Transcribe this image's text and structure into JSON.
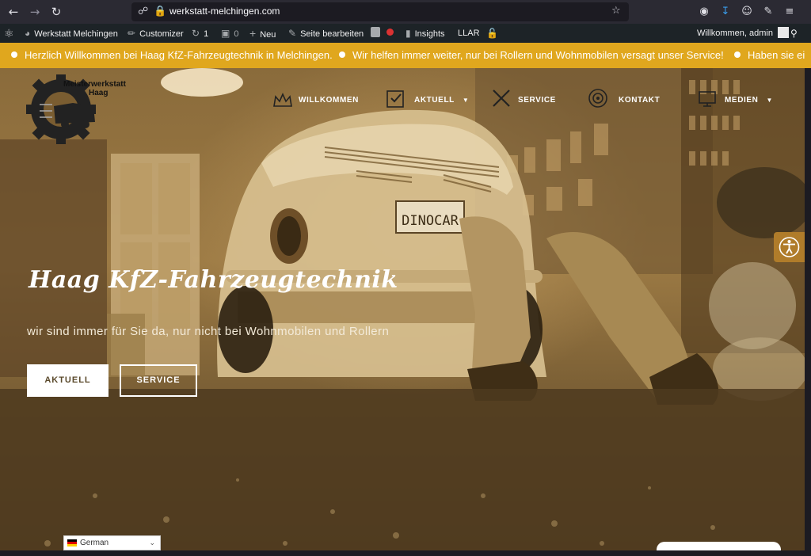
{
  "browser": {
    "url": "werkstatt-melchingen.com"
  },
  "wp_admin_bar": {
    "site_name": "Werkstatt Melchingen",
    "customizer": "Customizer",
    "updates_count": "1",
    "comments_count": "0",
    "new_label": "Neu",
    "edit_page": "Seite bearbeiten",
    "insights": "Insights",
    "llar": "LLAR",
    "greeting": "Willkommen, admin"
  },
  "ticker": {
    "items": [
      "Herzlich Willkommen bei Haag KfZ-Fahrzeugtechnik in Melchingen.",
      "Wir helfen immer weiter, nur bei Rollern und Wohnmobilen versagt unser Service!",
      "Haben sie ei"
    ]
  },
  "logo": {
    "line1": "Meisterwerkstatt",
    "line2": "Haag"
  },
  "menu": {
    "items": [
      {
        "label": "WILLKOMMEN",
        "icon": "crown-icon"
      },
      {
        "label": "AKTUELL",
        "icon": "clipboard-check-icon",
        "dropdown": true
      },
      {
        "label": "SERVICE",
        "icon": "wrench-screwdriver-icon"
      },
      {
        "label": "KONTAKT",
        "icon": "target-icon"
      },
      {
        "label": "MEDIEN",
        "icon": "monitor-icon",
        "dropdown": true
      }
    ]
  },
  "hero": {
    "title": "Haag KfZ-Fahrzeugtechnik",
    "subtitle": "wir sind immer für Sie da, nur nicht bei Wohnmobilen und Rollern",
    "button_primary": "AKTUELL",
    "button_secondary": "SERVICE",
    "license_plate": "DINOCAR"
  },
  "language": {
    "selected": "German"
  },
  "colors": {
    "ticker_bg": "#e0a71e",
    "wp_bar_bg": "#1d2327",
    "browser_bg": "#2b2a33",
    "hero_tint": "#8a6b3b"
  }
}
